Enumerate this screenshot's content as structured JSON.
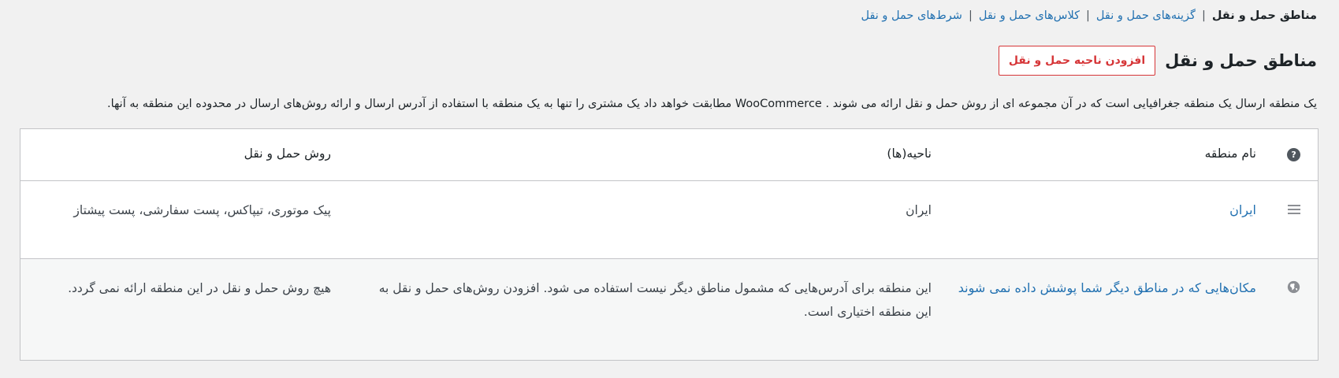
{
  "subnav": {
    "current": "مناطق حمل و نقل",
    "links": [
      "گزینه‌های حمل و نقل",
      "کلاس‌های حمل و نقل",
      "شرط‌های حمل و نقل"
    ],
    "separator": "|"
  },
  "header": {
    "title": "مناطق حمل و نقل",
    "add_button": "افزودن ناحیه حمل و نقل"
  },
  "description": "یک منطقه ارسال یک منطقه جغرافیایی است که در آن مجموعه ای از روش حمل و نقل ارائه می شوند . WooCommerce مطابقت خواهد داد یک مشتری را تنها به یک منطقه با استفاده از آدرس ارسال و ارائه روش‌های ارسال در محدوده این منطقه به آنها.",
  "table": {
    "columns": {
      "name": "نام منطقه",
      "regions": "ناحیه(ها)",
      "methods": "روش حمل و نقل"
    },
    "rows": [
      {
        "name": "ایران",
        "regions": "ایران",
        "methods": "پیک موتوری، تیپاکس، پست سفارشی، پست پیشتاز"
      },
      {
        "name": "مکان‌هایی که در مناطق دیگر شما پوشش داده نمی شوند",
        "regions": "این منطقه برای آدرس‌هایی که مشمول مناطق دیگر نیست استفاده می شود. افزودن روش‌های حمل و نقل به این منطقه اختیاری است.",
        "methods": "هیچ روش حمل و نقل در این منطقه ارائه نمی گردد."
      }
    ]
  },
  "icons": {
    "help": "help-icon",
    "drag": "drag-handle-icon",
    "globe": "globe-icon"
  },
  "colors": {
    "link": "#2271b1",
    "danger": "#d63638",
    "border": "#c3c4c7"
  }
}
